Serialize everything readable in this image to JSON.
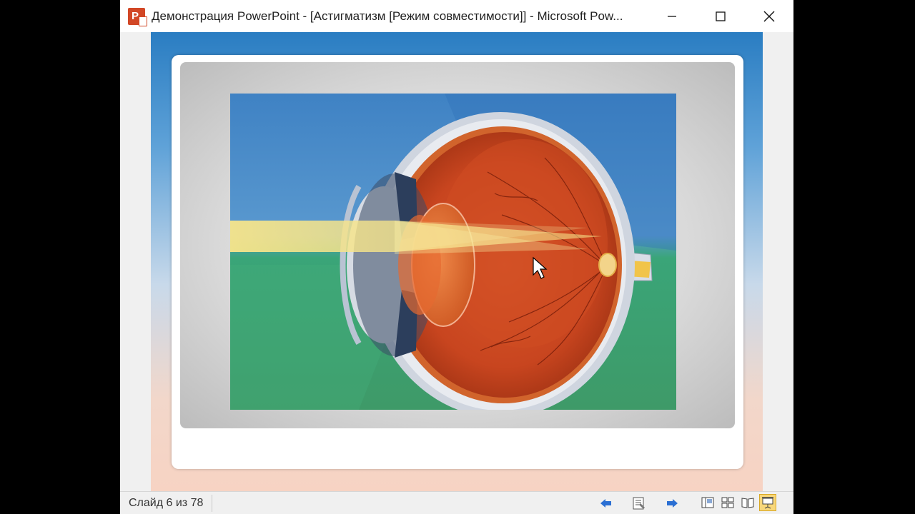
{
  "window": {
    "title": "Демонстрация PowerPoint - [Астигматизм [Режим совместимости]] - Microsoft Pow...",
    "app_icon_letter": "P",
    "controls": {
      "minimize": "minimize-icon",
      "maximize": "maximize-icon",
      "close": "close-icon"
    }
  },
  "slide": {
    "illustration": "eye-cross-section-icon"
  },
  "statusbar": {
    "slide_counter": "Слайд 6 из 78",
    "nav": [
      "previous-slide-icon",
      "menu-icon",
      "next-slide-icon"
    ],
    "views": [
      "normal-view-icon",
      "slide-sorter-icon",
      "reading-view-icon",
      "slide-show-icon"
    ],
    "active_view": "slide-show-icon"
  },
  "colors": {
    "titlebar_bg": "#ffffff",
    "slide_background_top": "#2a7dc2",
    "slide_background_bottom": "#f7d3c3",
    "eye_red": "#c8451f",
    "light_beam": "#f7e58a",
    "active_view_highlight": "#f8d77a"
  }
}
